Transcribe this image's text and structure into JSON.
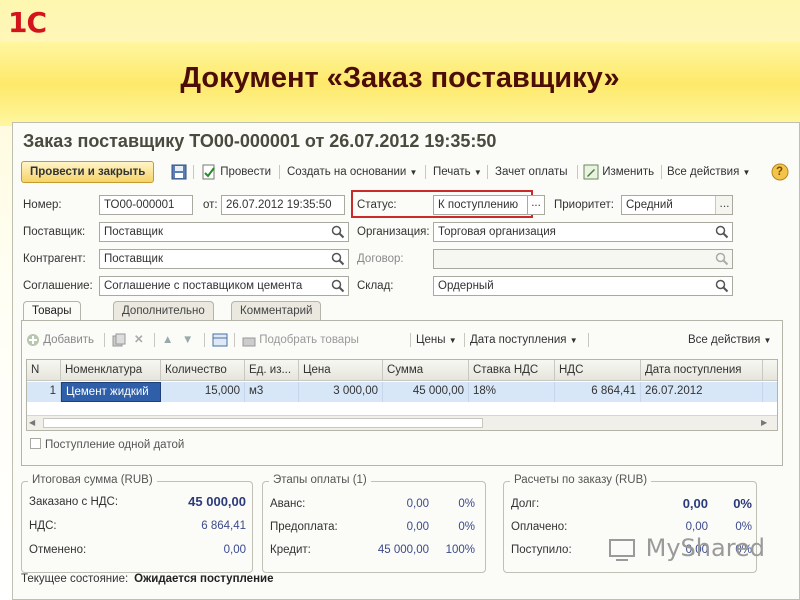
{
  "slide": {
    "logo_text": "1С",
    "title": "Документ «Заказ поставщику»",
    "watermark": "MyShared"
  },
  "window": {
    "title": "Заказ поставщику ТО00-000001 от 26.07.2012 19:35:50"
  },
  "toolbar": {
    "post_close": "Провести и закрыть",
    "post": "Провести",
    "create_based": "Создать на основании",
    "print": "Печать",
    "payment_offset": "Зачет оплаты",
    "edit": "Изменить",
    "all_actions": "Все действия",
    "help": "?"
  },
  "form": {
    "number_label": "Номер:",
    "number_value": "ТО00-000001",
    "date_label": "от:",
    "date_value": "26.07.2012 19:35:50",
    "status_label": "Статус:",
    "status_value": "К поступлению",
    "priority_label": "Приоритет:",
    "priority_value": "Средний",
    "supplier_label": "Поставщик:",
    "supplier_value": "Поставщик",
    "org_label": "Организация:",
    "org_value": "Торговая организация",
    "counterparty_label": "Контрагент:",
    "counterparty_value": "Поставщик",
    "contract_label": "Договор:",
    "contract_value": "",
    "agreement_label": "Соглашение:",
    "agreement_value": "Соглашение с поставщиком цемента",
    "warehouse_label": "Склад:",
    "warehouse_value": "Ордерный",
    "ellipsis": "..."
  },
  "tabs": [
    "Товары (1)",
    "Дополнительно",
    "Комментарий"
  ],
  "goods_toolbar": {
    "add": "Добавить",
    "pick_goods": "Подобрать товары",
    "prices": "Цены",
    "receipt_date": "Дата поступления",
    "all_actions": "Все действия"
  },
  "table": {
    "headers": [
      "N",
      "Номенклатура",
      "Количество",
      "Ед. из...",
      "Цена",
      "Сумма",
      "Ставка НДС",
      "НДС",
      "Дата поступления"
    ],
    "rows": [
      [
        "1",
        "Цемент жидкий",
        "15,000",
        "м3",
        "3 000,00",
        "45 000,00",
        "18%",
        "6 864,41",
        "26.07.2012"
      ]
    ]
  },
  "single_date_label": "Поступление одной датой",
  "totals": {
    "title": "Итоговая сумма (RUB)",
    "ordered_label": "Заказано с НДС:",
    "ordered_value": "45 000,00",
    "vat_label": "НДС:",
    "vat_value": "6 864,41",
    "cancelled_label": "Отменено:",
    "cancelled_value": "0,00"
  },
  "payment_stages": {
    "title": "Этапы оплаты (1)",
    "rows": [
      {
        "label": "Аванс:",
        "amount": "0,00",
        "pct": "0%"
      },
      {
        "label": "Предоплата:",
        "amount": "0,00",
        "pct": "0%"
      },
      {
        "label": "Кредит:",
        "amount": "45 000,00",
        "pct": "100%"
      }
    ]
  },
  "settlements": {
    "title": "Расчеты по заказу (RUB)",
    "rows": [
      {
        "label": "Долг:",
        "amount": "0,00",
        "pct": "0%"
      },
      {
        "label": "Оплачено:",
        "amount": "0,00",
        "pct": "0%"
      },
      {
        "label": "Поступило:",
        "amount": "0,00",
        "pct": "0%"
      }
    ]
  },
  "current_state": {
    "label": "Текущее состояние:",
    "value": "Ожидается поступление"
  }
}
